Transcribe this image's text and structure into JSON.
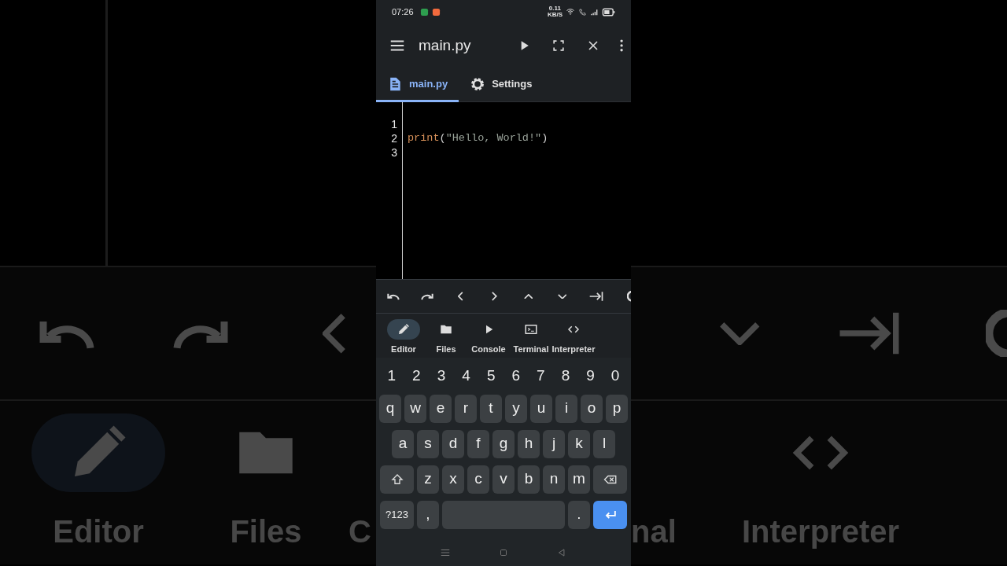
{
  "backdrop": {
    "left": {
      "toolbar": [
        {
          "kind": "undo"
        },
        {
          "kind": "redo"
        },
        {
          "kind": "left"
        }
      ],
      "nav": [
        {
          "kind": "pencil",
          "label": "Editor",
          "selected": true
        },
        {
          "kind": "folder",
          "label": "Files",
          "selected": false
        },
        {
          "kind": "text",
          "label": "C",
          "selected": false
        }
      ]
    },
    "right": {
      "toolbar": [
        {
          "kind": "down"
        },
        {
          "kind": "tab"
        },
        {
          "kind": "partial"
        }
      ],
      "nav": [
        {
          "kind": "text",
          "label": "nal",
          "selected": false
        },
        {
          "kind": "code",
          "label": "Interpreter",
          "selected": false
        }
      ]
    }
  },
  "status_bar": {
    "time": "07:26",
    "net_speed": "0.11",
    "net_unit": "KB/S"
  },
  "app_bar": {
    "title": "main.py",
    "actions": [
      {
        "kind": "play"
      },
      {
        "kind": "fullscreen"
      },
      {
        "kind": "close"
      },
      {
        "kind": "more"
      }
    ]
  },
  "tabs": [
    {
      "kind": "file",
      "label": "main.py",
      "selected": true
    },
    {
      "kind": "gear",
      "label": "Settings",
      "selected": false
    }
  ],
  "editor": {
    "lines": [
      {
        "number": "1"
      },
      {
        "number": "2",
        "tokens": [
          {
            "kind": "function",
            "text": "print"
          },
          {
            "kind": "punct",
            "text": "("
          },
          {
            "kind": "string",
            "text": "\"Hello, World!\""
          },
          {
            "kind": "punct",
            "text": ")"
          }
        ]
      },
      {
        "number": "3"
      }
    ]
  },
  "key_toolbar": [
    {
      "kind": "undo"
    },
    {
      "kind": "redo"
    },
    {
      "kind": "left"
    },
    {
      "kind": "right"
    },
    {
      "kind": "up"
    },
    {
      "kind": "down"
    },
    {
      "kind": "tab"
    },
    {
      "kind": "partial"
    }
  ],
  "bottom_nav": [
    {
      "kind": "pencil",
      "label": "Editor",
      "selected": true
    },
    {
      "kind": "folder",
      "label": "Files",
      "selected": false
    },
    {
      "kind": "play",
      "label": "Console",
      "selected": false
    },
    {
      "kind": "terminal",
      "label": "Terminal",
      "selected": false
    },
    {
      "kind": "code",
      "label": "Interpreter",
      "selected": false
    }
  ],
  "keyboard": {
    "number_row": [
      "1",
      "2",
      "3",
      "4",
      "5",
      "6",
      "7",
      "8",
      "9",
      "0"
    ],
    "rows": [
      [
        {
          "kind": "letter",
          "label": "q"
        },
        {
          "kind": "letter",
          "label": "w"
        },
        {
          "kind": "letter",
          "label": "e"
        },
        {
          "kind": "letter",
          "label": "r"
        },
        {
          "kind": "letter",
          "label": "t"
        },
        {
          "kind": "letter",
          "label": "y"
        },
        {
          "kind": "letter",
          "label": "u"
        },
        {
          "kind": "letter",
          "label": "i"
        },
        {
          "kind": "letter",
          "label": "o"
        },
        {
          "kind": "letter",
          "label": "p"
        }
      ],
      [
        {
          "kind": "letter",
          "label": "a"
        },
        {
          "kind": "letter",
          "label": "s"
        },
        {
          "kind": "letter",
          "label": "d"
        },
        {
          "kind": "letter",
          "label": "f"
        },
        {
          "kind": "letter",
          "label": "g"
        },
        {
          "kind": "letter",
          "label": "h"
        },
        {
          "kind": "letter",
          "label": "j"
        },
        {
          "kind": "letter",
          "label": "k"
        },
        {
          "kind": "letter",
          "label": "l"
        }
      ],
      [
        {
          "kind": "shift"
        },
        {
          "kind": "letter",
          "label": "z"
        },
        {
          "kind": "letter",
          "label": "x"
        },
        {
          "kind": "letter",
          "label": "c"
        },
        {
          "kind": "letter",
          "label": "v"
        },
        {
          "kind": "letter",
          "label": "b"
        },
        {
          "kind": "letter",
          "label": "n"
        },
        {
          "kind": "letter",
          "label": "m"
        },
        {
          "kind": "backspace"
        }
      ]
    ],
    "bottom_row": {
      "symbols": "?123",
      "comma": ",",
      "period": "."
    }
  },
  "nav_bar": [
    {
      "kind": "menu"
    },
    {
      "kind": "home"
    },
    {
      "kind": "back"
    }
  ]
}
